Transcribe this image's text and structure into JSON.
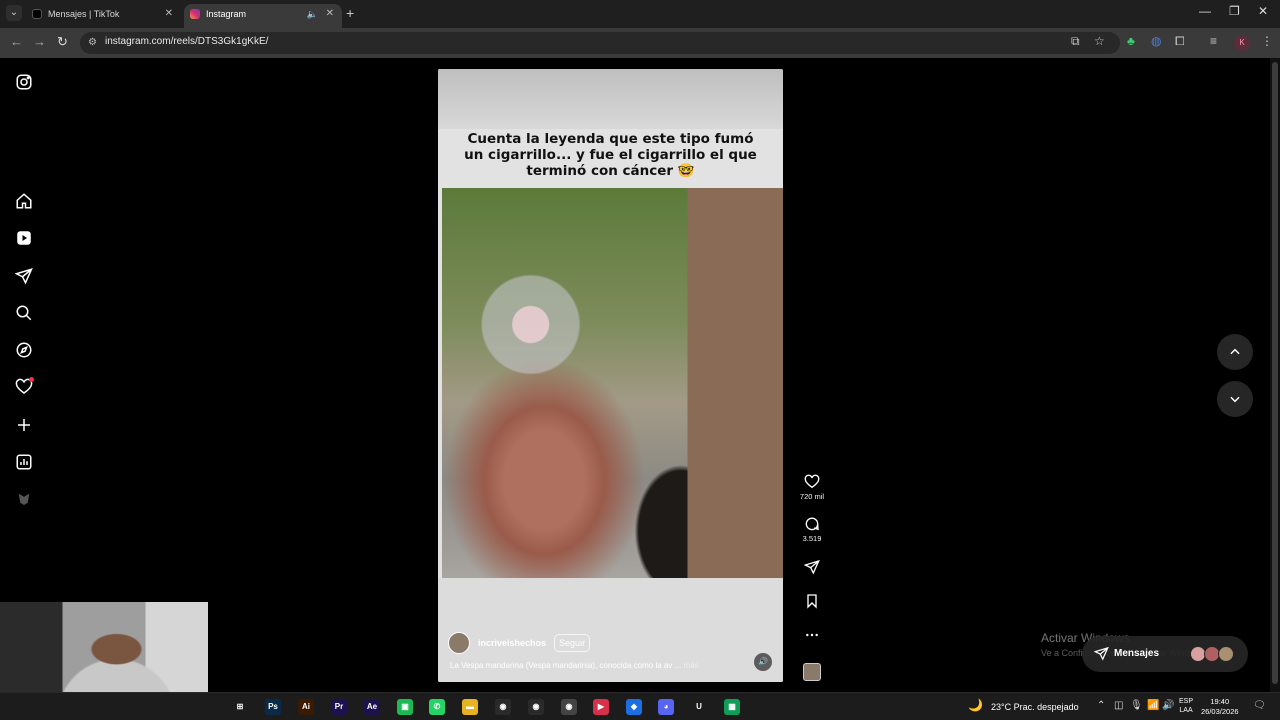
{
  "browser": {
    "tabs": [
      {
        "title": "Mensajes | TikTok",
        "active": false
      },
      {
        "title": "Instagram",
        "active": true
      }
    ],
    "new_tab": "+",
    "url": "instagram.com/reels/DTS3Gk1gKkE/",
    "profile_initial": "K"
  },
  "reel": {
    "caption_overlay": "Cuenta la leyenda que este tipo fumó un cigarrillo... y fue el cigarrillo el que terminó con cáncer 🤓",
    "username": "incriveishechos",
    "follow_label": "Seguir",
    "description": "La Vespa mandarina (Vespa mandarinia), conocida como la av ...",
    "more_label": "más"
  },
  "actions": {
    "likes": "720 mil",
    "comments": "3.519"
  },
  "overlays": {
    "activate_title": "Activar Windows",
    "activate_sub": "Ve a Configuración para activar Windows.",
    "messages_label": "Mensajes"
  },
  "taskbar": {
    "apps": [
      {
        "name": "task-view-icon",
        "glyph": "⊞",
        "color": "#1c1c1c"
      },
      {
        "name": "photoshop-icon",
        "glyph": "Ps",
        "color": "#0b2a4a"
      },
      {
        "name": "illustrator-icon",
        "glyph": "Ai",
        "color": "#3a1a00"
      },
      {
        "name": "premiere-icon",
        "glyph": "Pr",
        "color": "#1e1150"
      },
      {
        "name": "after-effects-icon",
        "glyph": "Ae",
        "color": "#1e1150"
      },
      {
        "name": "green-app-icon",
        "glyph": "▣",
        "color": "#1db954"
      },
      {
        "name": "whatsapp-icon",
        "glyph": "✆",
        "color": "#25d366"
      },
      {
        "name": "file-explorer-icon",
        "glyph": "▬",
        "color": "#e6b422"
      },
      {
        "name": "chrome-icon",
        "glyph": "◉",
        "color": "#2a2a2a"
      },
      {
        "name": "chrome-icon-2",
        "glyph": "◉",
        "color": "#2a2a2a"
      },
      {
        "name": "chrome-icon-active",
        "glyph": "◉",
        "color": "#444"
      },
      {
        "name": "media-player-icon",
        "glyph": "▶",
        "color": "#d6304a"
      },
      {
        "name": "app-icon-blue",
        "glyph": "◆",
        "color": "#1c6fe0"
      },
      {
        "name": "discord-icon",
        "glyph": "◕",
        "color": "#5865f2"
      },
      {
        "name": "upwork-icon",
        "glyph": "U",
        "color": "#1c1c1c"
      },
      {
        "name": "sheets-icon",
        "glyph": "▦",
        "color": "#0f9d58"
      }
    ],
    "weather_temp": "23°C",
    "weather_text": "Prac. despejado",
    "lang_top": "ESP",
    "lang_bottom": "LAA",
    "time": "19:40",
    "date": "26/03/2026"
  }
}
